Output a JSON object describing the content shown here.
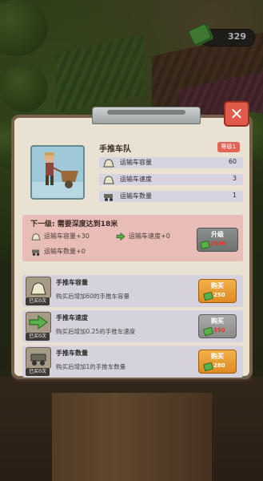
{
  "currency": {
    "amount": "329",
    "icon": "cash-icon"
  },
  "panel": {
    "title": "手推车队",
    "level_badge": "等级1",
    "close_icon": "close-icon",
    "stats": [
      {
        "icon": "cart-capacity-icon",
        "label": "运输车容量",
        "value": "60"
      },
      {
        "icon": "cart-speed-icon",
        "label": "运输车速度",
        "value": "3"
      },
      {
        "icon": "cart-count-icon",
        "label": "运输车数量",
        "value": "1"
      }
    ],
    "next_level": {
      "title": "下一级: 需要深度达到18米",
      "capacity": "运输车容量+30",
      "speed": "运输车速度+0",
      "count": "运输车数量+0",
      "upgrade_label": "升级",
      "upgrade_cost": "2500"
    },
    "items": [
      {
        "name": "手推车容量",
        "bought": "已买0次",
        "desc": "购买后增加60的手推车容量",
        "button": "购买",
        "cost": "250",
        "style": "orange",
        "icon": "cart-capacity-icon"
      },
      {
        "name": "手推车速度",
        "bought": "已买0次",
        "desc": "购买后增加0.25的手推车速度",
        "button": "购买",
        "cost": "350",
        "style": "gray",
        "icon": "speed-arrow-icon"
      },
      {
        "name": "手推车数量",
        "bought": "已买0次",
        "desc": "购买后增加1的手推车数量",
        "button": "购买",
        "cost": "280",
        "style": "orange",
        "icon": "cart-count-icon"
      }
    ]
  },
  "colors": {
    "accent_red": "#e05a4a",
    "panel_bg": "#e9e2d2",
    "next_bg": "#e8bcb7",
    "buy_orange": "#f2b14a"
  }
}
